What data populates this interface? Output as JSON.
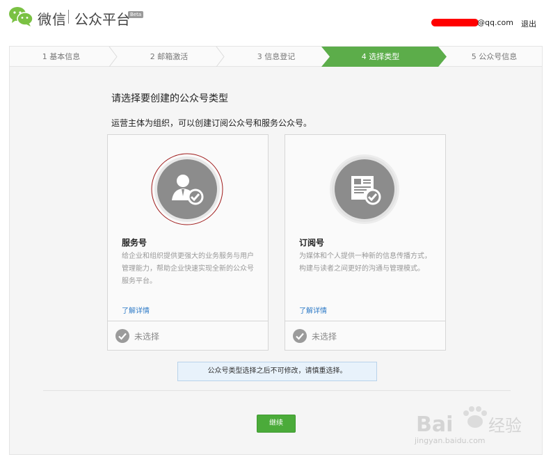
{
  "header": {
    "logo_icon": "wechat-logo-icon",
    "title": "微信",
    "subtitle": "公众平台",
    "beta": "Beta",
    "user_email_suffix": "@qq.com",
    "logout": "退出"
  },
  "steps": [
    {
      "label": "1 基本信息",
      "active": false
    },
    {
      "label": "2 邮箱激活",
      "active": false
    },
    {
      "label": "3 信息登记",
      "active": false
    },
    {
      "label": "4 选择类型",
      "active": true
    },
    {
      "label": "5 公众号信息",
      "active": false
    }
  ],
  "content": {
    "title": "请选择要创建的公众号类型",
    "description": "运营主体为组织，可以创建订阅公众号和服务公众号。"
  },
  "cards": [
    {
      "icon": "service-account-icon",
      "name": "服务号",
      "description": "给企业和组织提供更强大的业务服务与用户管理能力，帮助企业快速实现全新的公众号服务平台。",
      "link": "了解详情",
      "status": "未选择"
    },
    {
      "icon": "subscription-account-icon",
      "name": "订阅号",
      "description": "为媒体和个人提供一种新的信息传播方式，构建与读者之间更好的沟通与管理模式。",
      "link": "了解详情",
      "status": "未选择"
    }
  ],
  "notice": "公众号类型选择之后不可修改，请慎重选择。",
  "continue_label": "继续",
  "watermark": {
    "text": "Bai 经验",
    "url": "jingyan.baidu.com"
  },
  "colors": {
    "active_step": "#5cad4a",
    "primary_button": "#4bab3a",
    "link": "#2f7bc7",
    "icon_circle": "#8c8c8c",
    "selection_ring": "#a01c1c"
  }
}
